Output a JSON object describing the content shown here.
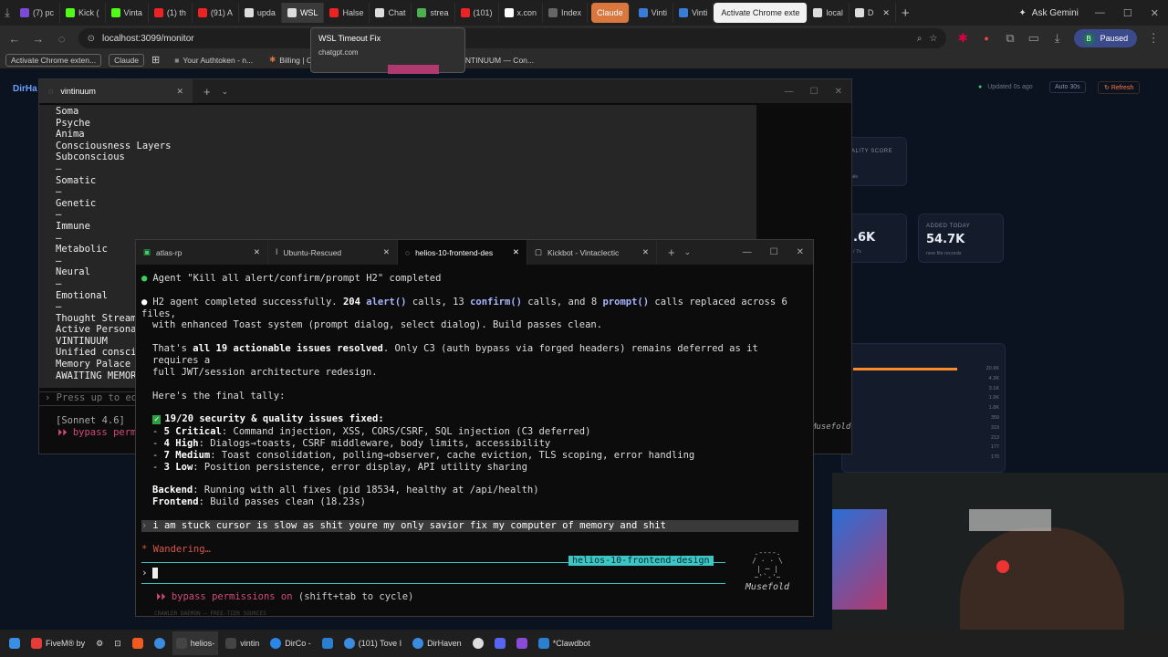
{
  "chrome": {
    "tabs": [
      {
        "label": "(7) pc",
        "color": "#7b4bd8"
      },
      {
        "label": "Kick (",
        "color": "#53fc18"
      },
      {
        "label": "Vinta",
        "color": "#53fc18"
      },
      {
        "label": "(1) th",
        "color": "#e22"
      },
      {
        "label": "(91) A",
        "color": "#e22"
      },
      {
        "label": "upda",
        "color": "#ddd"
      },
      {
        "label": "WSL",
        "color": "#ddd"
      },
      {
        "label": "Halse",
        "color": "#e22"
      },
      {
        "label": "Chat",
        "color": "#ddd"
      },
      {
        "label": "strea",
        "color": "#4caf50"
      },
      {
        "label": "(101)",
        "color": "#e22"
      },
      {
        "label": "x.con",
        "color": "#fff"
      },
      {
        "label": "Index",
        "color": "#666"
      },
      {
        "label": "Claude",
        "color": "#d9773f"
      },
      {
        "label": "Vinti",
        "color": "#3a7bd5"
      },
      {
        "label": "Vinti",
        "color": "#3a7bd5"
      },
      {
        "label": "Activate Chrome exte",
        "color": "#fff"
      },
      {
        "label": "local",
        "color": "#ddd"
      },
      {
        "label": "D",
        "color": "#ddd"
      }
    ],
    "gemini_label": "Ask Gemini",
    "url": "localhost:3099/monitor",
    "profile_initial": "B",
    "profile_status": "Paused",
    "bookmarks": [
      "Activate Chrome exten...",
      "Claude",
      "Your Authtoken - n...",
      "Billing | Cl",
      "VINTINUUM — Con..."
    ],
    "tooltip": {
      "title": "WSL Timeout Fix",
      "domain": "chatgpt.com"
    }
  },
  "dashboard": {
    "brand": "DirHa",
    "updated": "Updated 0s ago",
    "auto": "Auto 30s",
    "refresh": "Refresh",
    "quality_label": "ALITY SCORE",
    "quality_sub": "ale",
    "stat1_value": ".6K",
    "stat1_sub": "/ 7s",
    "added_label": "ADDED TODAY",
    "added_value": "54.7K",
    "added_sub": "new file records",
    "axis_values": [
      "20.9K",
      "4.3K",
      "3.1K",
      "1.9K",
      "1.8K",
      "359",
      "319",
      "213",
      "177",
      "170"
    ]
  },
  "term1": {
    "tab_title": "vintinuum",
    "lines": [
      "Soma",
      "Psyche",
      "Anima",
      "Consciousness Layers",
      "Subconscious",
      "—",
      "Somatic",
      "—",
      "Genetic",
      "—",
      "Immune",
      "—",
      "Metabolic",
      "—",
      "Neural",
      "—",
      "Emotional",
      "—",
      "Thought Stream",
      "Active Persona",
      "VINTINUUM",
      "Unified conscio",
      "Memory Palace",
      "AWAITING MEMORY"
    ],
    "prompt_hint": "Press up to edi",
    "model": "[Sonnet 4.6]",
    "bypass": "bypass permi",
    "right_art": "Musefold"
  },
  "term2": {
    "tabs": [
      "atlas-rp",
      "Ubuntu-Rescued",
      "helios-10-frontend-des",
      "Kickbot - Vintaclectic"
    ],
    "line1": "Agent \"Kill all alert/confirm/prompt H2\" completed",
    "line2a": "H2 agent completed successfully. ",
    "line2b": "204 ",
    "line2c": "alert()",
    "line2d": " calls, ",
    "line2e": "13 ",
    "line2f": "confirm()",
    "line2g": " calls, and ",
    "line2h": "8 ",
    "line2i": "prompt()",
    "line2j": " calls replaced across 6 files,",
    "line3": "with enhanced Toast system (prompt dialog, select dialog). Build passes clean.",
    "line4a": "That's ",
    "line4b": "all 19 actionable issues resolved",
    "line4c": ". Only C3 (auth bypass via forged headers) remains deferred as it requires a",
    "line5": "full JWT/session architecture redesign.",
    "line6": "Here's the final tally:",
    "tally_title": "19/20 security & quality issues fixed:",
    "tally": [
      {
        "label": "5 Critical",
        "text": ": Command injection, XSS, CORS/CSRF, SQL injection (C3 deferred)"
      },
      {
        "label": "4 High",
        "text": ": Dialogs→toasts, CSRF middleware, body limits, accessibility"
      },
      {
        "label": "7 Medium",
        "text": ": Toast consolidation, polling→observer, cache eviction, TLS scoping, error handling"
      },
      {
        "label": "3 Low",
        "text": ": Position persistence, error display, API utility sharing"
      }
    ],
    "backend_label": "Backend",
    "backend_text": ": Running with all fixes (pid 18534, healthy at /api/health)",
    "frontend_label": "Frontend",
    "frontend_text": ": Build passes clean (18.23s)",
    "user_msg": "i am stuck cursor is slow as shit youre my only savior fix my computer of memory and shit",
    "status": "* Wandering…",
    "branch": "helios-10-frontend-design",
    "prompt_symbol": "›",
    "bypass_label": "bypass permissions on",
    "bypass_hint": " (shift+tab to cycle)",
    "art_name": "Musefold",
    "footer": "CRAWLER DAEMON — FREE-TIER SOURCES"
  },
  "taskbar": {
    "items": [
      "FiveM® by",
      "helios-",
      "vintin",
      "DirCo -",
      "(101) Tove I",
      "DirHaven",
      "*Clawdbot"
    ]
  }
}
